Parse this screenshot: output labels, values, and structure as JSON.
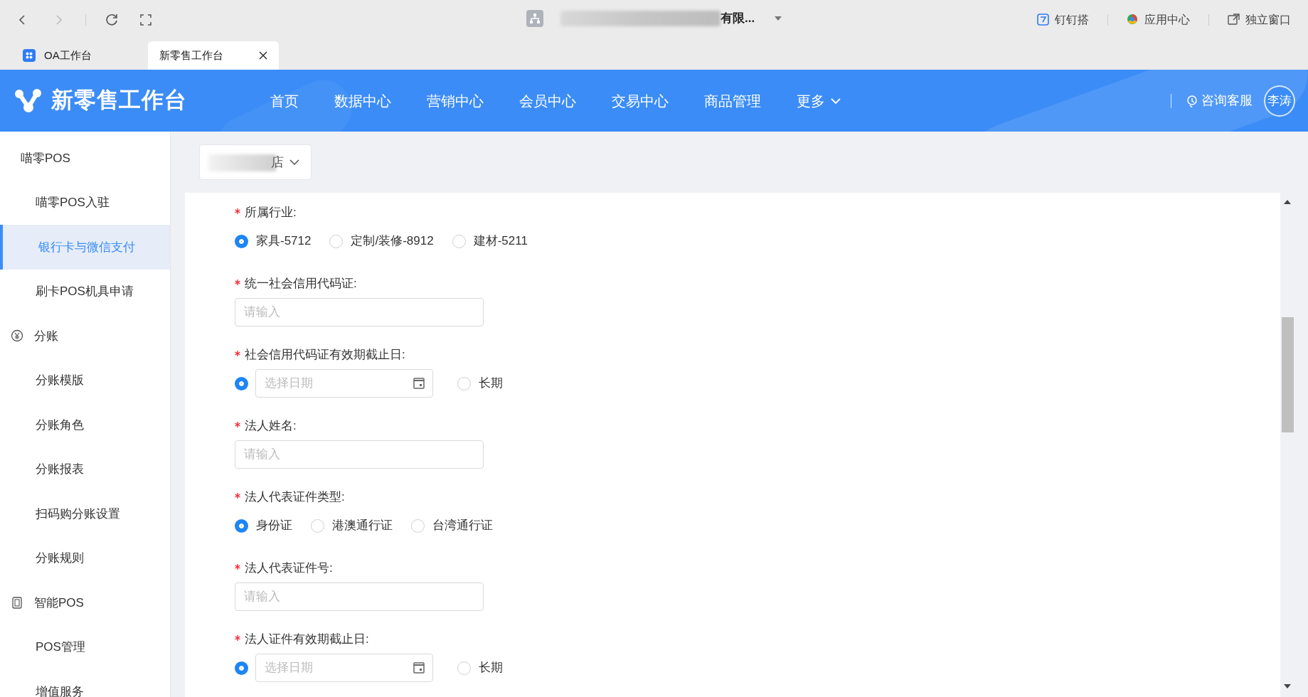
{
  "browser": {
    "org_name": "有限...",
    "back_disabled": false,
    "forward_disabled": true,
    "actions": [
      "钉钉搭",
      "应用中心",
      "独立窗口"
    ],
    "tabs": [
      {
        "label": "OA工作台",
        "selected": false,
        "closable": false
      },
      {
        "label": "新零售工作台",
        "selected": true,
        "closable": true
      }
    ]
  },
  "header": {
    "title": "新零售工作台",
    "nav": [
      {
        "label": "首页"
      },
      {
        "label": "数据中心"
      },
      {
        "label": "营销中心"
      },
      {
        "label": "会员中心"
      },
      {
        "label": "交易中心"
      },
      {
        "label": "商品管理"
      },
      {
        "label": "更多",
        "dropdown": true
      }
    ],
    "support": "咨询客服",
    "avatar": "李涛"
  },
  "sidebar": {
    "groups": [
      {
        "label": "喵零POS",
        "kind": "plain",
        "children": [
          {
            "label": "喵零POS入驻",
            "selected": false
          },
          {
            "label": "银行卡与微信支付",
            "selected": true
          },
          {
            "label": "刷卡POS机具申请",
            "selected": false
          }
        ]
      },
      {
        "label": "分账",
        "kind": "money",
        "children": [
          {
            "label": "分账模版",
            "selected": false
          },
          {
            "label": "分账角色",
            "selected": false
          },
          {
            "label": "分账报表",
            "selected": false
          },
          {
            "label": "扫码购分账设置",
            "selected": false
          },
          {
            "label": "分账规则",
            "selected": false
          }
        ]
      },
      {
        "label": "智能POS",
        "kind": "device",
        "children": [
          {
            "label": "POS管理",
            "selected": false
          },
          {
            "label": "增值服务",
            "selected": false
          }
        ]
      }
    ]
  },
  "store_select": {
    "value": "店"
  },
  "form": {
    "fields": [
      {
        "kind": "radio",
        "label": "所属行业:",
        "required": true,
        "options": [
          {
            "label": "家具-5712",
            "selected": true
          },
          {
            "label": "定制/装修-8912",
            "selected": false
          },
          {
            "label": "建材-5211",
            "selected": false
          }
        ]
      },
      {
        "kind": "input",
        "label": "统一社会信用代码证:",
        "required": true,
        "placeholder": "请输入"
      },
      {
        "kind": "date",
        "label": "社会信用代码证有效期截止日:",
        "required": true,
        "date_selected": true,
        "placeholder": "选择日期",
        "alt_label": "长期",
        "alt_selected": false
      },
      {
        "kind": "input",
        "label": "法人姓名:",
        "required": true,
        "placeholder": "请输入"
      },
      {
        "kind": "radio",
        "label": "法人代表证件类型:",
        "required": true,
        "options": [
          {
            "label": "身份证",
            "selected": true
          },
          {
            "label": "港澳通行证",
            "selected": false
          },
          {
            "label": "台湾通行证",
            "selected": false
          }
        ]
      },
      {
        "kind": "input",
        "label": "法人代表证件号:",
        "required": true,
        "placeholder": "请输入"
      },
      {
        "kind": "date",
        "label": "法人证件有效期截止日:",
        "required": true,
        "date_selected": true,
        "placeholder": "选择日期",
        "alt_label": "长期",
        "alt_selected": false
      }
    ]
  }
}
